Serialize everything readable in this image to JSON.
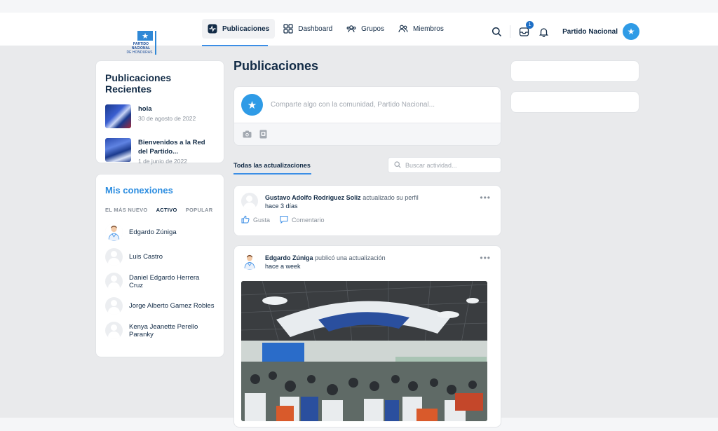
{
  "header": {
    "logo_lines": [
      "PARTIDO",
      "NACIONAL",
      "DE HONDURAS"
    ],
    "nav": [
      {
        "label": "Publicaciones",
        "icon": "activity-icon",
        "active": true
      },
      {
        "label": "Dashboard",
        "icon": "grid-icon",
        "active": false
      },
      {
        "label": "Grupos",
        "icon": "groups-icon",
        "active": false
      },
      {
        "label": "Miembros",
        "icon": "members-icon",
        "active": false
      }
    ],
    "messages_badge": "1",
    "user_name": "Partido Nacional"
  },
  "recent_posts": {
    "title": "Publicaciones Recientes",
    "items": [
      {
        "title": "hola",
        "date": "30 de agosto de 2022"
      },
      {
        "title": "Bienvenidos a la Red del Partido...",
        "date": "1 de junio de 2022"
      }
    ]
  },
  "connections": {
    "title": "Mis conexiones",
    "tabs": [
      "EL MÁS NUEVO",
      "ACTIVO",
      "POPULAR"
    ],
    "active_tab": "ACTIVO",
    "members": [
      "Edgardo Zúniga",
      "Luis Castro",
      "Daniel Edgardo Herrera Cruz",
      "Jorge Alberto Gamez Robles",
      "Kenya Jeanette Perello Paranky"
    ]
  },
  "main": {
    "title": "Publicaciones",
    "composer_placeholder": "Comparte algo con la comunidad, Partido Nacional...",
    "tab_label": "Todas las actualizaciones",
    "search_placeholder": "Buscar actividad...",
    "posts": [
      {
        "author": "Gustavo Adolfo Rodriguez Soliz",
        "action": "actualizado su perfil",
        "time": "hace 3 días",
        "like_label": "Gusta",
        "comment_label": "Comentario"
      },
      {
        "author": "Edgardo Zúniga",
        "action": "publicó una actualización",
        "time": "hace a week"
      }
    ]
  },
  "colors": {
    "accent": "#2c8de0",
    "text": "#122b46",
    "muted": "#8a929c"
  }
}
